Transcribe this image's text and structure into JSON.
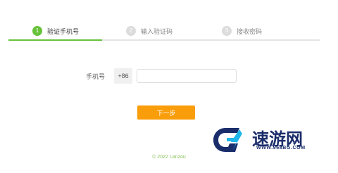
{
  "steps": {
    "items": [
      {
        "num": "1",
        "label": "验证手机号",
        "state": "active"
      },
      {
        "num": "2",
        "label": "输入验证码",
        "state": "todo"
      },
      {
        "num": "3",
        "label": "接收密码",
        "state": "todo"
      }
    ],
    "progress_fraction": 0.3
  },
  "form": {
    "phone_label": "手机号",
    "country_code": "+86",
    "phone_value": "",
    "phone_placeholder": ""
  },
  "buttons": {
    "next_label": "下一步"
  },
  "footer": {
    "copyright": "© 2022 Lanzou"
  },
  "watermark": {
    "title": "速游网",
    "url": "WWW.968BG.COM"
  },
  "colors": {
    "accent_green": "#67c23a",
    "button_orange": "#fa9d0a",
    "watermark_blue": "#1a2d6b",
    "watermark_cyan": "#1fb6ea"
  }
}
